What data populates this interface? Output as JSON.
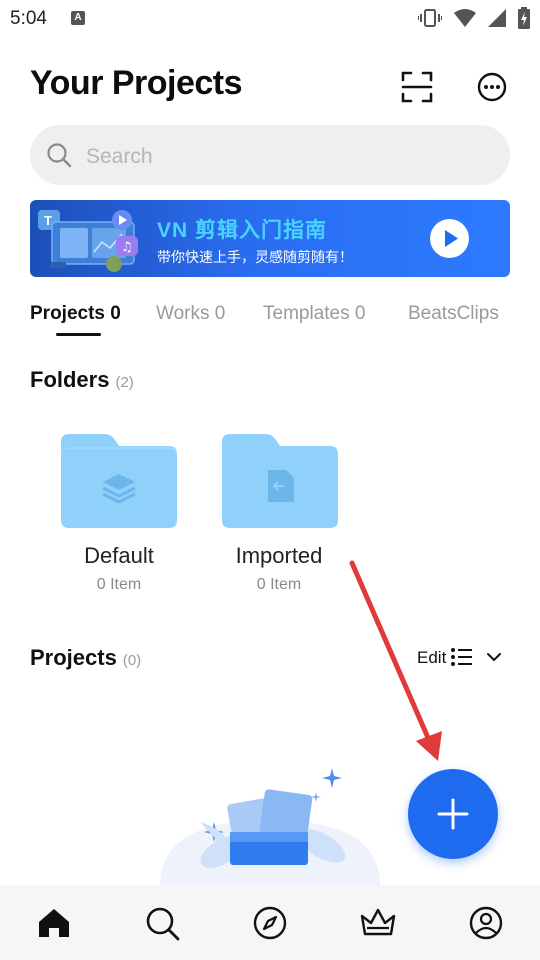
{
  "status_bar": {
    "time": "5:04",
    "notification_badge": "A"
  },
  "header": {
    "title": "Your Projects",
    "scan_icon": "scan-icon",
    "more_icon": "more-options-icon"
  },
  "search": {
    "placeholder": "Search",
    "value": ""
  },
  "banner": {
    "title": "VN 剪辑入门指南",
    "subtitle": "带你快速上手，灵感随剪随有！"
  },
  "tabs": [
    {
      "label": "Projects 0",
      "active": true
    },
    {
      "label": "Works 0",
      "active": false
    },
    {
      "label": "Templates 0",
      "active": false
    },
    {
      "label": "BeatsClips",
      "active": false
    }
  ],
  "folders_section": {
    "title": "Folders",
    "count": "(2)",
    "items": [
      {
        "name": "Default",
        "count": "0 Item",
        "icon": "layers-icon"
      },
      {
        "name": "Imported",
        "count": "0 Item",
        "icon": "import-file-icon"
      }
    ]
  },
  "projects_section": {
    "title": "Projects",
    "count": "(0)",
    "edit_label": "Edit"
  },
  "bottom_nav": [
    {
      "name": "home",
      "icon": "home-icon",
      "active": true
    },
    {
      "name": "search",
      "icon": "search-icon",
      "active": false
    },
    {
      "name": "explore",
      "icon": "compass-icon",
      "active": false
    },
    {
      "name": "premium",
      "icon": "crown-icon",
      "active": false
    },
    {
      "name": "profile",
      "icon": "profile-icon",
      "active": false
    }
  ],
  "colors": {
    "accent": "#1e6bf0",
    "banner_title": "#49d4ff",
    "folder": "#8fd1fb",
    "annotation_arrow": "#e03a3a"
  }
}
